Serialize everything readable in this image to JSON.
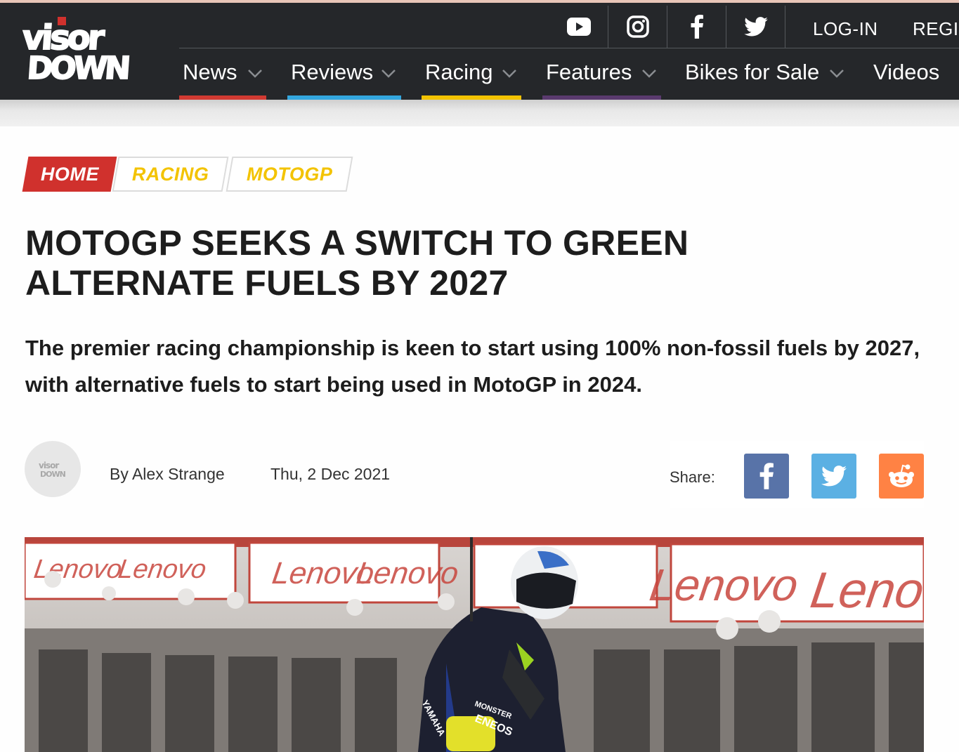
{
  "site": {
    "logo_text_line1": "visor",
    "logo_text_line2": "DOWN"
  },
  "utility": {
    "social_icons": [
      "youtube-icon",
      "instagram-icon",
      "facebook-icon",
      "twitter-icon"
    ],
    "login_label": "LOG-IN",
    "register_label": "REGIS"
  },
  "nav": {
    "items": [
      {
        "label": "News",
        "accent": "#d13a32"
      },
      {
        "label": "Reviews",
        "accent": "#33a6de"
      },
      {
        "label": "Racing",
        "accent": "#f3c300"
      },
      {
        "label": "Features",
        "accent": "#5a3a6e"
      },
      {
        "label": "Bikes for Sale",
        "accent": ""
      },
      {
        "label": "Videos",
        "accent": ""
      }
    ]
  },
  "breadcrumb": {
    "items": [
      "HOME",
      "RACING",
      "MOTOGP"
    ]
  },
  "article": {
    "title": "MOTOGP SEEKS A SWITCH TO GREEN ALTERNATE FUELS BY 2027",
    "standfirst": "The premier racing championship is keen to start using 100% non-fossil fuels by 2027, with alternative fuels to start being used in MotoGP in 2024.",
    "author": "By Alex Strange",
    "date": "Thu, 2 Dec 2021"
  },
  "share": {
    "label": "Share:",
    "buttons": [
      {
        "icon": "facebook-icon",
        "color": "#5873a8"
      },
      {
        "icon": "twitter-icon",
        "color": "#5bb0e3"
      },
      {
        "icon": "reddit-icon",
        "color": "#ff8244"
      }
    ]
  },
  "hero_image": {
    "sponsor_text": "Lenovo",
    "rider_suit_text": [
      "YAMAHA",
      "MONSTER",
      "ENEOS"
    ]
  },
  "colors": {
    "header_bg": "#25272a",
    "brand_red": "#d0312d",
    "racing_yellow": "#f3c300"
  }
}
